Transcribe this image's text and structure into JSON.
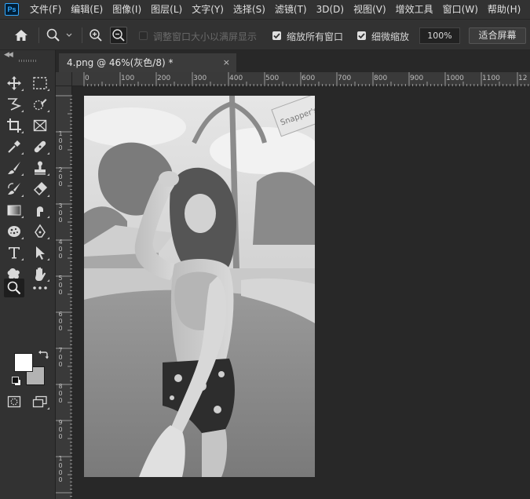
{
  "app": {
    "logo_text": "Ps"
  },
  "menu": [
    "文件(F)",
    "编辑(E)",
    "图像(I)",
    "图层(L)",
    "文字(Y)",
    "选择(S)",
    "滤镜(T)",
    "3D(D)",
    "视图(V)",
    "增效工具",
    "窗口(W)",
    "帮助(H)"
  ],
  "options": {
    "resize_windows_label": "调整窗口大小以满屏显示",
    "zoom_all_label": "缩放所有窗口",
    "scrubby_zoom_label": "细微缩放",
    "zoom_value": "100%",
    "fit_screen_label": "适合屏幕"
  },
  "document": {
    "tab_title": "4.png @ 46%(灰色/8) *",
    "close": "×"
  },
  "ruler": {
    "h_labels": [
      "0",
      "100",
      "200",
      "300",
      "400",
      "500",
      "600",
      "700",
      "800",
      "900",
      "1000",
      "1100",
      "12"
    ],
    "v_labels": [
      "1\n0\n0",
      "2\n0\n0",
      "3\n0\n0",
      "4\n0\n0",
      "5\n0\n0",
      "6\n0\n0",
      "7\n0\n0",
      "8\n0\n0",
      "9\n0\n0",
      "1\n0\n0\n0"
    ]
  },
  "photo": {
    "sign_text": "Snapper's"
  },
  "colors": {
    "foreground": "#ffffff",
    "background": "#b3b3b3",
    "accent": "#31a8ff"
  }
}
